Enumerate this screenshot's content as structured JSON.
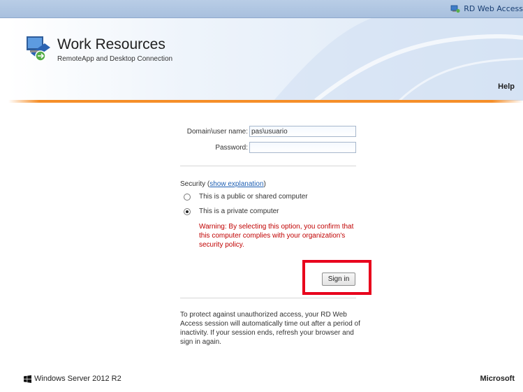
{
  "topbar": {
    "link_label": "RD Web Access",
    "link_icon": "rd-web-access-icon"
  },
  "header": {
    "title": "Work Resources",
    "subtitle": "RemoteApp and Desktop Connection",
    "help_label": "Help",
    "logo_icon": "remote-desktop-logo-icon"
  },
  "login": {
    "username_label": "Domain\\user name:",
    "username_value": "pas\\usuario",
    "password_label": "Password:",
    "password_value": ""
  },
  "security": {
    "prefix": "Security (",
    "link_label": "show explanation",
    "suffix": ")",
    "options": [
      {
        "label": "This is a public or shared computer",
        "checked": false
      },
      {
        "label": "This is a private computer",
        "checked": true
      }
    ],
    "warning": "Warning: By selecting this option, you confirm that this computer complies with your organization's security policy."
  },
  "signin_label": "Sign in",
  "protect_notice": "To protect against unauthorized access, your RD Web Access session will automatically time out after a period of inactivity. If your session ends, refresh your browser and sign in again.",
  "footer": {
    "product": "Windows Server 2012 R2",
    "company": "Microsoft",
    "product_icon": "windows-logo-icon"
  },
  "colors": {
    "accent_orange": "#f58e28",
    "warning_red": "#c00000",
    "highlight_red": "#e8001c",
    "link_blue": "#1e5fb3"
  }
}
